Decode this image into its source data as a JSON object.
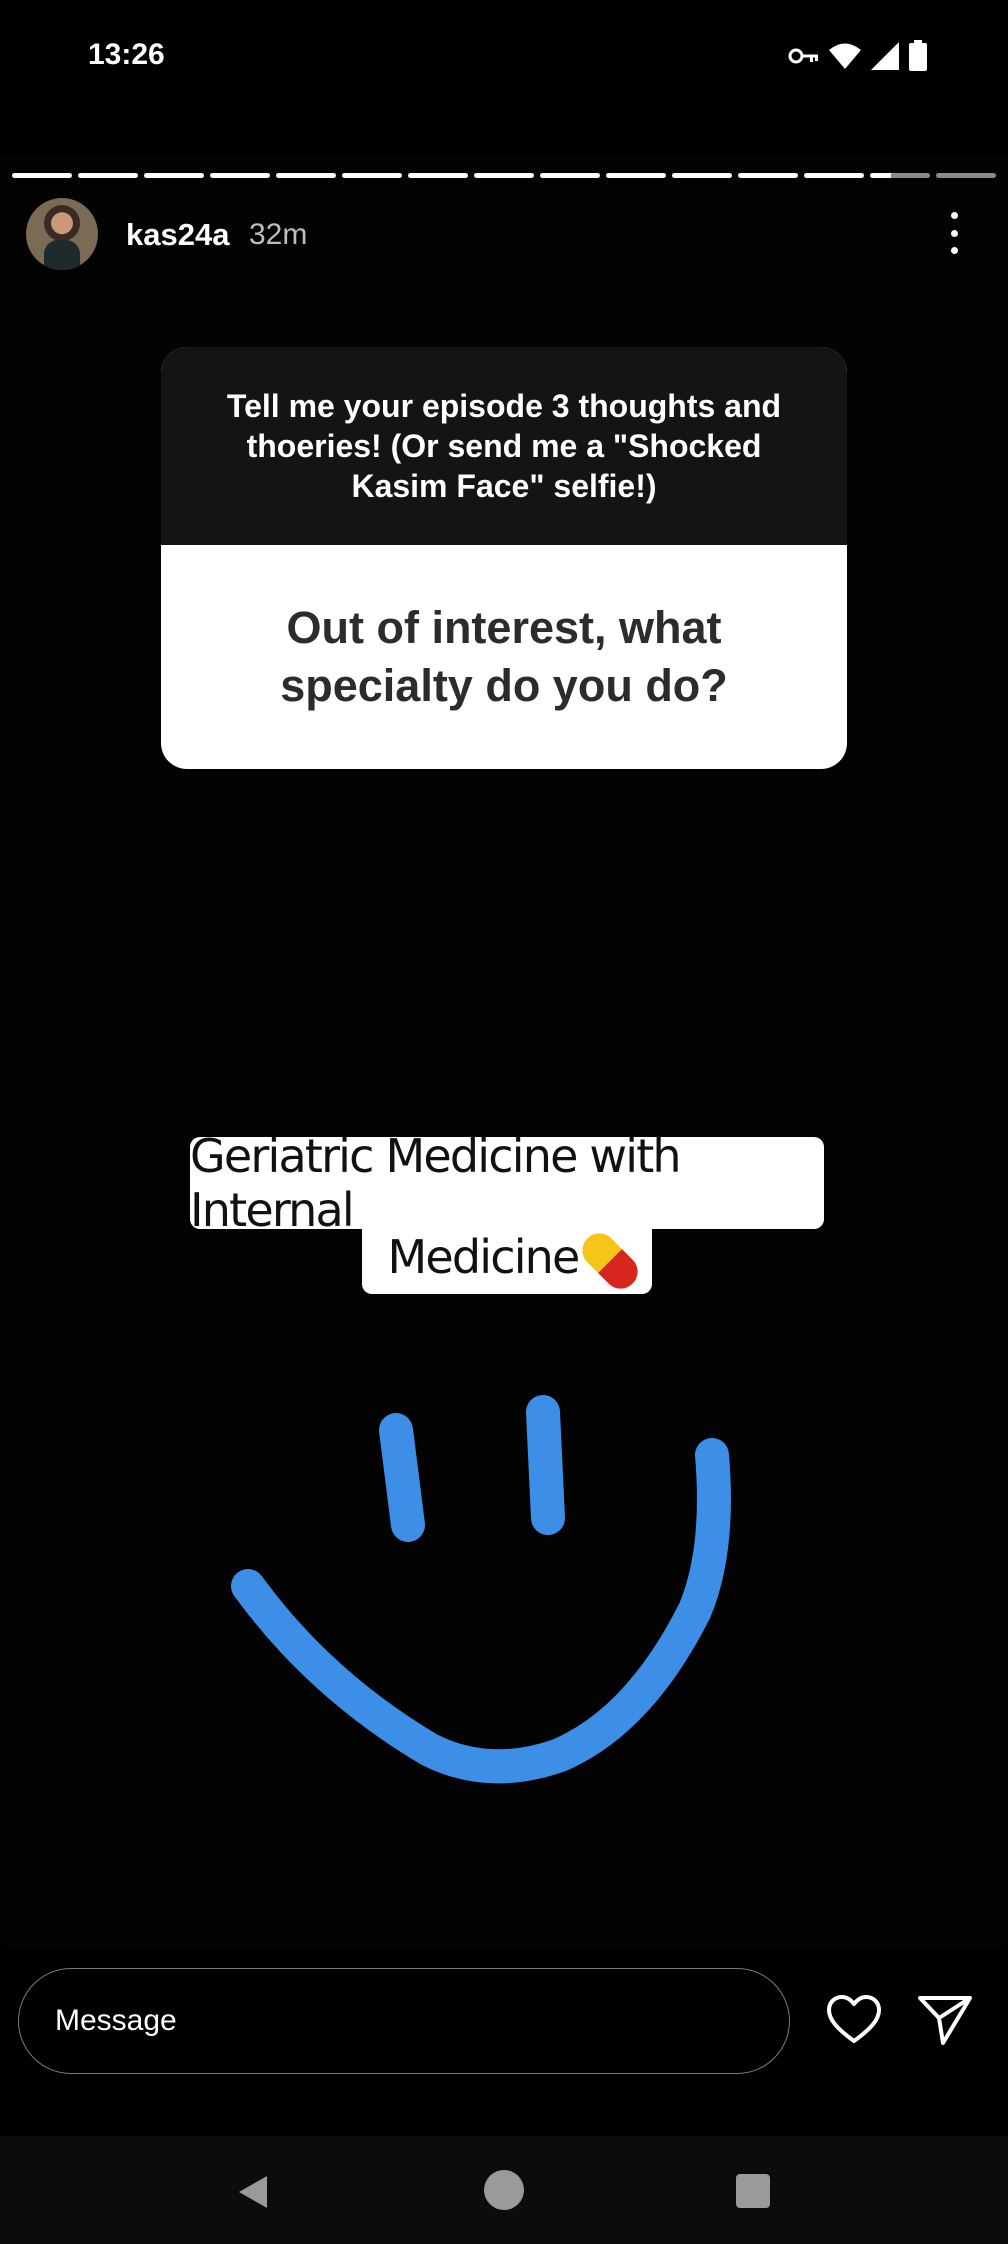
{
  "status_bar": {
    "time": "13:26",
    "icons": [
      "key-icon",
      "wifi-icon",
      "signal-icon",
      "battery-icon"
    ]
  },
  "story": {
    "progress": {
      "segments_total": 15,
      "segments_seen": 13,
      "current_segment_fraction": 0.35
    },
    "username": "kas24a",
    "time_ago": "32m",
    "question_sticker": {
      "prompt": "Tell me your episode 3 thoughts and thoeries! (Or send me a \"Shocked Kasim Face\" selfie!)",
      "question": "Out of interest, what specialty do you do?"
    },
    "answer": {
      "line1": "Geriatric Medicine with Internal",
      "line2": "Medicine"
    },
    "drawing_color": "#3d8ee6"
  },
  "reply_bar": {
    "message_placeholder": "Message"
  },
  "nav_bar": {
    "icons": [
      "back-icon",
      "home-icon",
      "recent-apps-icon"
    ]
  }
}
